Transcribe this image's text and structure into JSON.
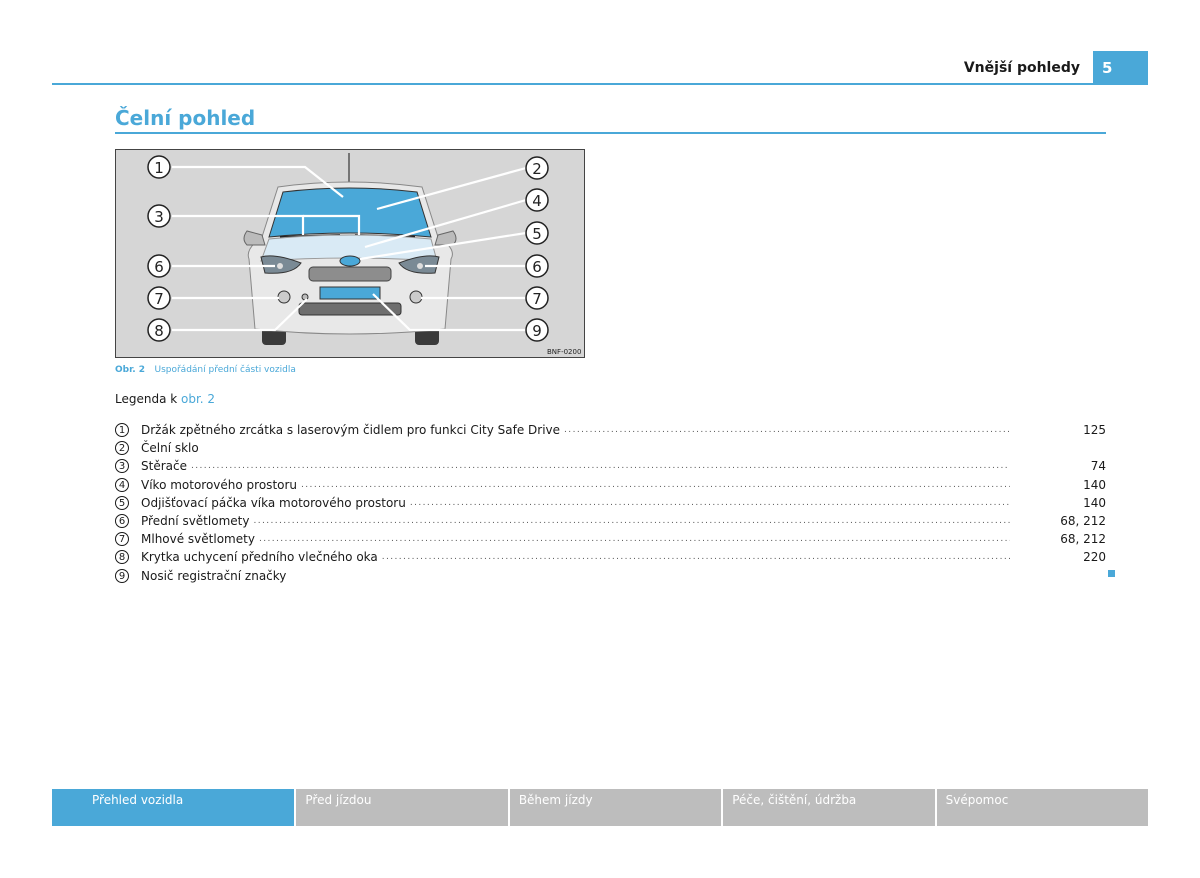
{
  "header": {
    "title": "Vnější pohledy",
    "page_number": "5"
  },
  "section": {
    "title": "Čelní pohled"
  },
  "figure": {
    "code": "BNF-0200",
    "callouts": [
      "1",
      "2",
      "3",
      "4",
      "5",
      "6",
      "6",
      "7",
      "7",
      "8",
      "9"
    ]
  },
  "caption": {
    "label": "Obr. 2",
    "text": "Uspořádání přední části vozidla"
  },
  "legend": {
    "intro": "Legenda k ",
    "link": "obr. 2",
    "items": [
      {
        "num": "1",
        "label": "Držák zpětného zrcátka s laserovým čidlem pro funkci City Safe Drive",
        "page": "125"
      },
      {
        "num": "2",
        "label": "Čelní sklo",
        "page": ""
      },
      {
        "num": "3",
        "label": "Stěrače",
        "page": "74"
      },
      {
        "num": "4",
        "label": "Víko motorového prostoru",
        "page": "140"
      },
      {
        "num": "5",
        "label": "Odjišťovací páčka víka motorového prostoru",
        "page": "140"
      },
      {
        "num": "6",
        "label": "Přední světlomety",
        "page": "68, 212"
      },
      {
        "num": "7",
        "label": "Mlhové světlomety",
        "page": "68, 212"
      },
      {
        "num": "8",
        "label": "Krytka uchycení předního vlečného oka",
        "page": "220"
      },
      {
        "num": "9",
        "label": "Nosič registrační značky",
        "page": ""
      }
    ]
  },
  "footer": {
    "tabs": [
      "Přehled vozidla",
      "Před jízdou",
      "Během jízdy",
      "Péče, čištění, údržba",
      "Svépomoc"
    ],
    "active_index": 0
  },
  "colors": {
    "accent": "#4aa8d8",
    "tab_inactive": "#bdbdbd",
    "figure_bg": "#d6d6d6"
  }
}
